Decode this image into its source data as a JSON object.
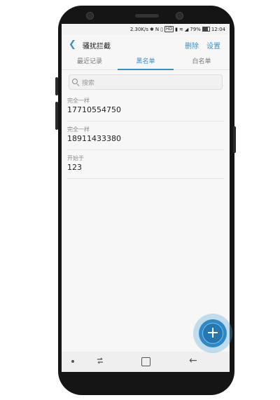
{
  "status_bar": {
    "speed": "2.30K/s",
    "hd_badge": "HD",
    "battery": "79%",
    "time": "12:04"
  },
  "header": {
    "title": "骚扰拦截",
    "delete_label": "删除",
    "settings_label": "设置"
  },
  "tabs": [
    {
      "label": "最近记录"
    },
    {
      "label": "黑名单"
    },
    {
      "label": "白名单"
    }
  ],
  "search": {
    "placeholder": "搜索"
  },
  "blacklist": [
    {
      "type": "完全一样",
      "value": "17710554750"
    },
    {
      "type": "完全一样",
      "value": "18911433380"
    },
    {
      "type": "开始于",
      "value": "123"
    }
  ],
  "colors": {
    "accent": "#3b8fc7",
    "fab": "#2f89c6"
  },
  "icons": {
    "back": "chevron-left-icon",
    "search": "search-icon",
    "fab": "add-icon"
  }
}
